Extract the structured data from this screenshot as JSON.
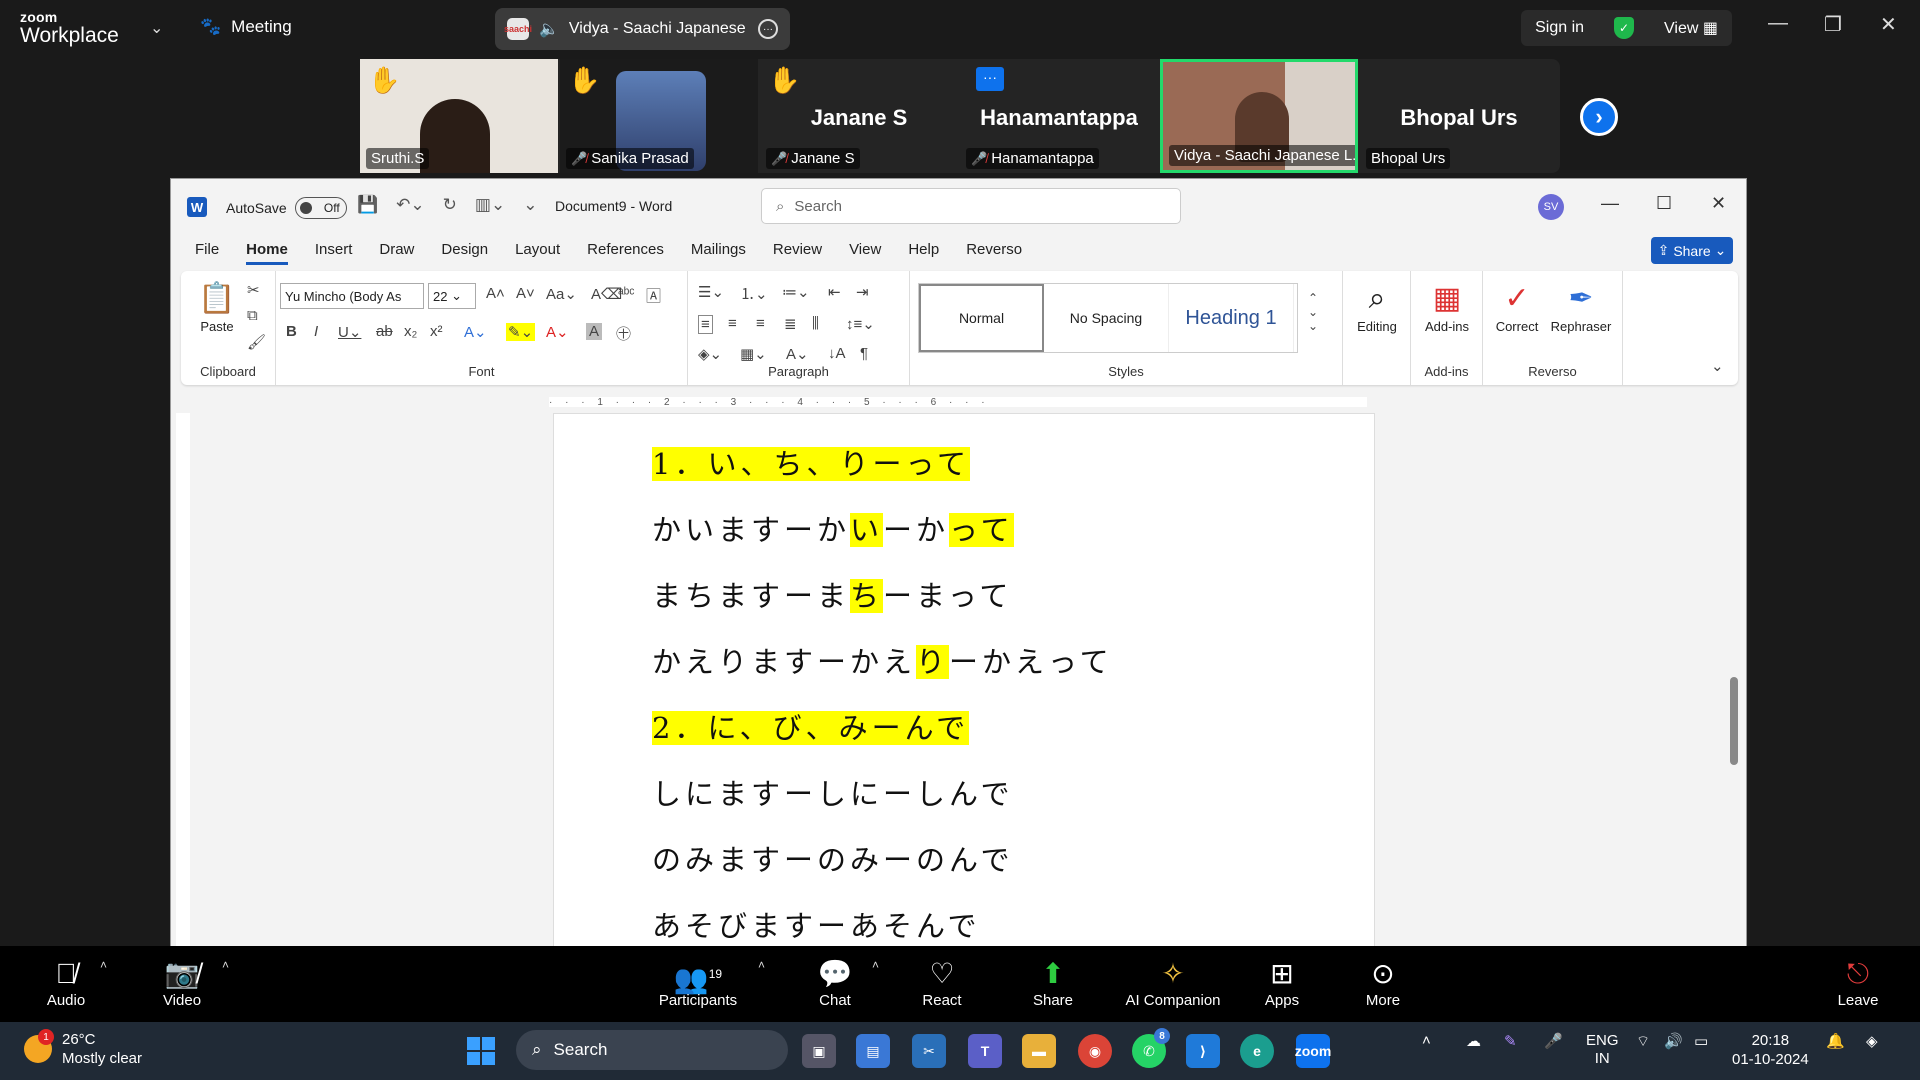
{
  "zoom": {
    "logo_top": "zoom",
    "logo_bottom": "Workplace",
    "meeting_label": "Meeting",
    "speaker_pill": "Vidya - Saachi Japanese Lan",
    "sign_in": "Sign in",
    "view": "View"
  },
  "participants": [
    {
      "name": "Sruthi.S",
      "big": "",
      "hand": true,
      "muted": false,
      "video": true
    },
    {
      "name": "Sanika Prasad",
      "big": "",
      "hand": true,
      "muted": true,
      "video": true
    },
    {
      "name": "Janane S",
      "big": "Janane S",
      "hand": true,
      "muted": true,
      "video": false
    },
    {
      "name": "Hanamantappa",
      "big": "Hanamantappa",
      "hand": false,
      "muted": true,
      "video": false
    },
    {
      "name": "Vidya - Saachi Japanese L...",
      "big": "",
      "hand": false,
      "muted": false,
      "video": true
    },
    {
      "name": "Bhopal Urs",
      "big": "Bhopal Urs",
      "hand": false,
      "muted": false,
      "video": false
    }
  ],
  "word": {
    "autosave": "AutoSave",
    "toggle": "Off",
    "doc_name": "Document9  -  Word",
    "search_placeholder": "Search",
    "avatar": "SV",
    "share": "Share",
    "tabs": [
      "File",
      "Home",
      "Insert",
      "Draw",
      "Design",
      "Layout",
      "References",
      "Mailings",
      "Review",
      "View",
      "Help",
      "Reverso"
    ],
    "font_name": "Yu Mincho (Body As",
    "font_size": "22",
    "paste": "Paste",
    "styles": [
      "Normal",
      "No Spacing",
      "Heading 1"
    ],
    "editing": "Editing",
    "addins": "Add-ins",
    "correct": "Correct",
    "rephraser": "Rephraser",
    "groups": {
      "clipboard": "Clipboard",
      "font": "Font",
      "paragraph": "Paragraph",
      "styles": "Styles",
      "addins": "Add-ins",
      "reverso": "Reverso"
    },
    "ruler": "· · · 1 · · · 2 · · · 3 · · · 4 · · · 5 · · · 6 · · ·"
  },
  "doc_lines": [
    [
      {
        "t": "1．い、ち、りーって",
        "h": true
      }
    ],
    [
      {
        "t": "かいますーか",
        "h": false
      },
      {
        "t": "い",
        "h": true
      },
      {
        "t": "ーか",
        "h": false
      },
      {
        "t": "って",
        "h": true
      }
    ],
    [
      {
        "t": "まちますーま",
        "h": false
      },
      {
        "t": "ち",
        "h": true
      },
      {
        "t": "ーまって",
        "h": false
      }
    ],
    [
      {
        "t": "かえりますーかえ",
        "h": false
      },
      {
        "t": "り",
        "h": true
      },
      {
        "t": "ーかえって",
        "h": false
      }
    ],
    [
      {
        "t": "2．に、び、みーんで",
        "h": true
      }
    ],
    [
      {
        "t": "しにますーしにーしんで",
        "h": false
      }
    ],
    [
      {
        "t": "のみますーのみーのんで",
        "h": false
      }
    ],
    [
      {
        "t": "あそびますーあそんで",
        "h": false
      }
    ]
  ],
  "controls": {
    "audio": "Audio",
    "video": "Video",
    "participants": "Participants",
    "participant_count": "19",
    "chat": "Chat",
    "react": "React",
    "share": "Share",
    "ai": "AI Companion",
    "apps": "Apps",
    "more": "More",
    "leave": "Leave"
  },
  "taskbar": {
    "temp": "26°C",
    "weather": "Mostly clear",
    "search": "Search",
    "lang1": "ENG",
    "lang2": "IN",
    "time": "20:18",
    "date": "01-10-2024",
    "weather_badge": "1",
    "whatsapp_badge": "8"
  }
}
